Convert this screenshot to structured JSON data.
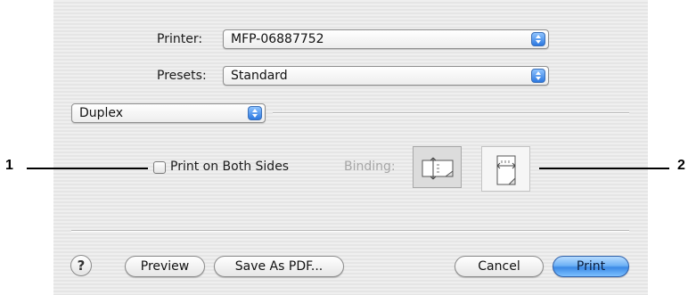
{
  "dialog": {
    "printer": {
      "label": "Printer:",
      "value": "MFP-06887752"
    },
    "presets": {
      "label": "Presets:",
      "value": "Standard"
    },
    "pane_menu": {
      "value": "Duplex"
    },
    "duplex": {
      "checkbox_label": "Print on Both Sides",
      "checked": false,
      "binding_label": "Binding:"
    },
    "buttons": {
      "help": "?",
      "preview": "Preview",
      "save_pdf": "Save As PDF...",
      "cancel": "Cancel",
      "print": "Print"
    }
  },
  "callouts": [
    "1",
    "2"
  ],
  "colors": {
    "accent": "#3c8ae6",
    "background": "#ececec"
  }
}
